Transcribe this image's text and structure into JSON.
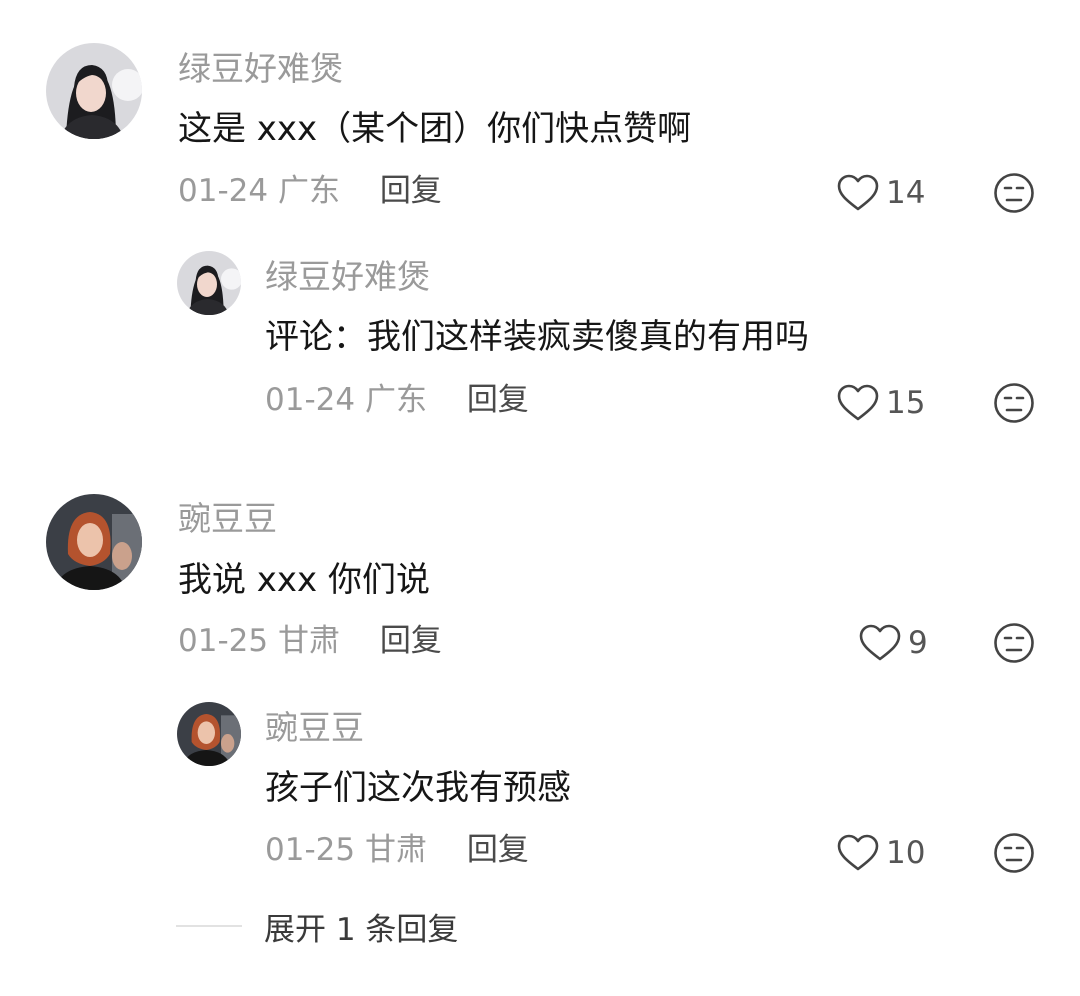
{
  "comments": [
    {
      "username": "绿豆好难煲",
      "text": "这是 xxx（某个团）你们快点赞啊",
      "date": "01-24",
      "location": "广东",
      "reply_label": "回复",
      "likes": "14"
    },
    {
      "username": "绿豆好难煲",
      "text": "评论：我们这样装疯卖傻真的有用吗",
      "date": "01-24",
      "location": "广东",
      "reply_label": "回复",
      "likes": "15"
    },
    {
      "username": "豌豆豆",
      "text": "我说 xxx 你们说",
      "date": "01-25",
      "location": "甘肃",
      "reply_label": "回复",
      "likes": "9"
    },
    {
      "username": "豌豆豆",
      "text": "孩子们这次我有预感",
      "date": "01-25",
      "location": "甘肃",
      "reply_label": "回复",
      "likes": "10"
    }
  ],
  "expand_replies": {
    "label": "展开 1 条回复"
  },
  "icons": {
    "like": "heart-outline-icon",
    "dislike": "neutral-face-icon"
  },
  "colors": {
    "secondary_text": "#9a9a9a",
    "primary_text": "#161616",
    "icon_stroke": "#444444"
  }
}
